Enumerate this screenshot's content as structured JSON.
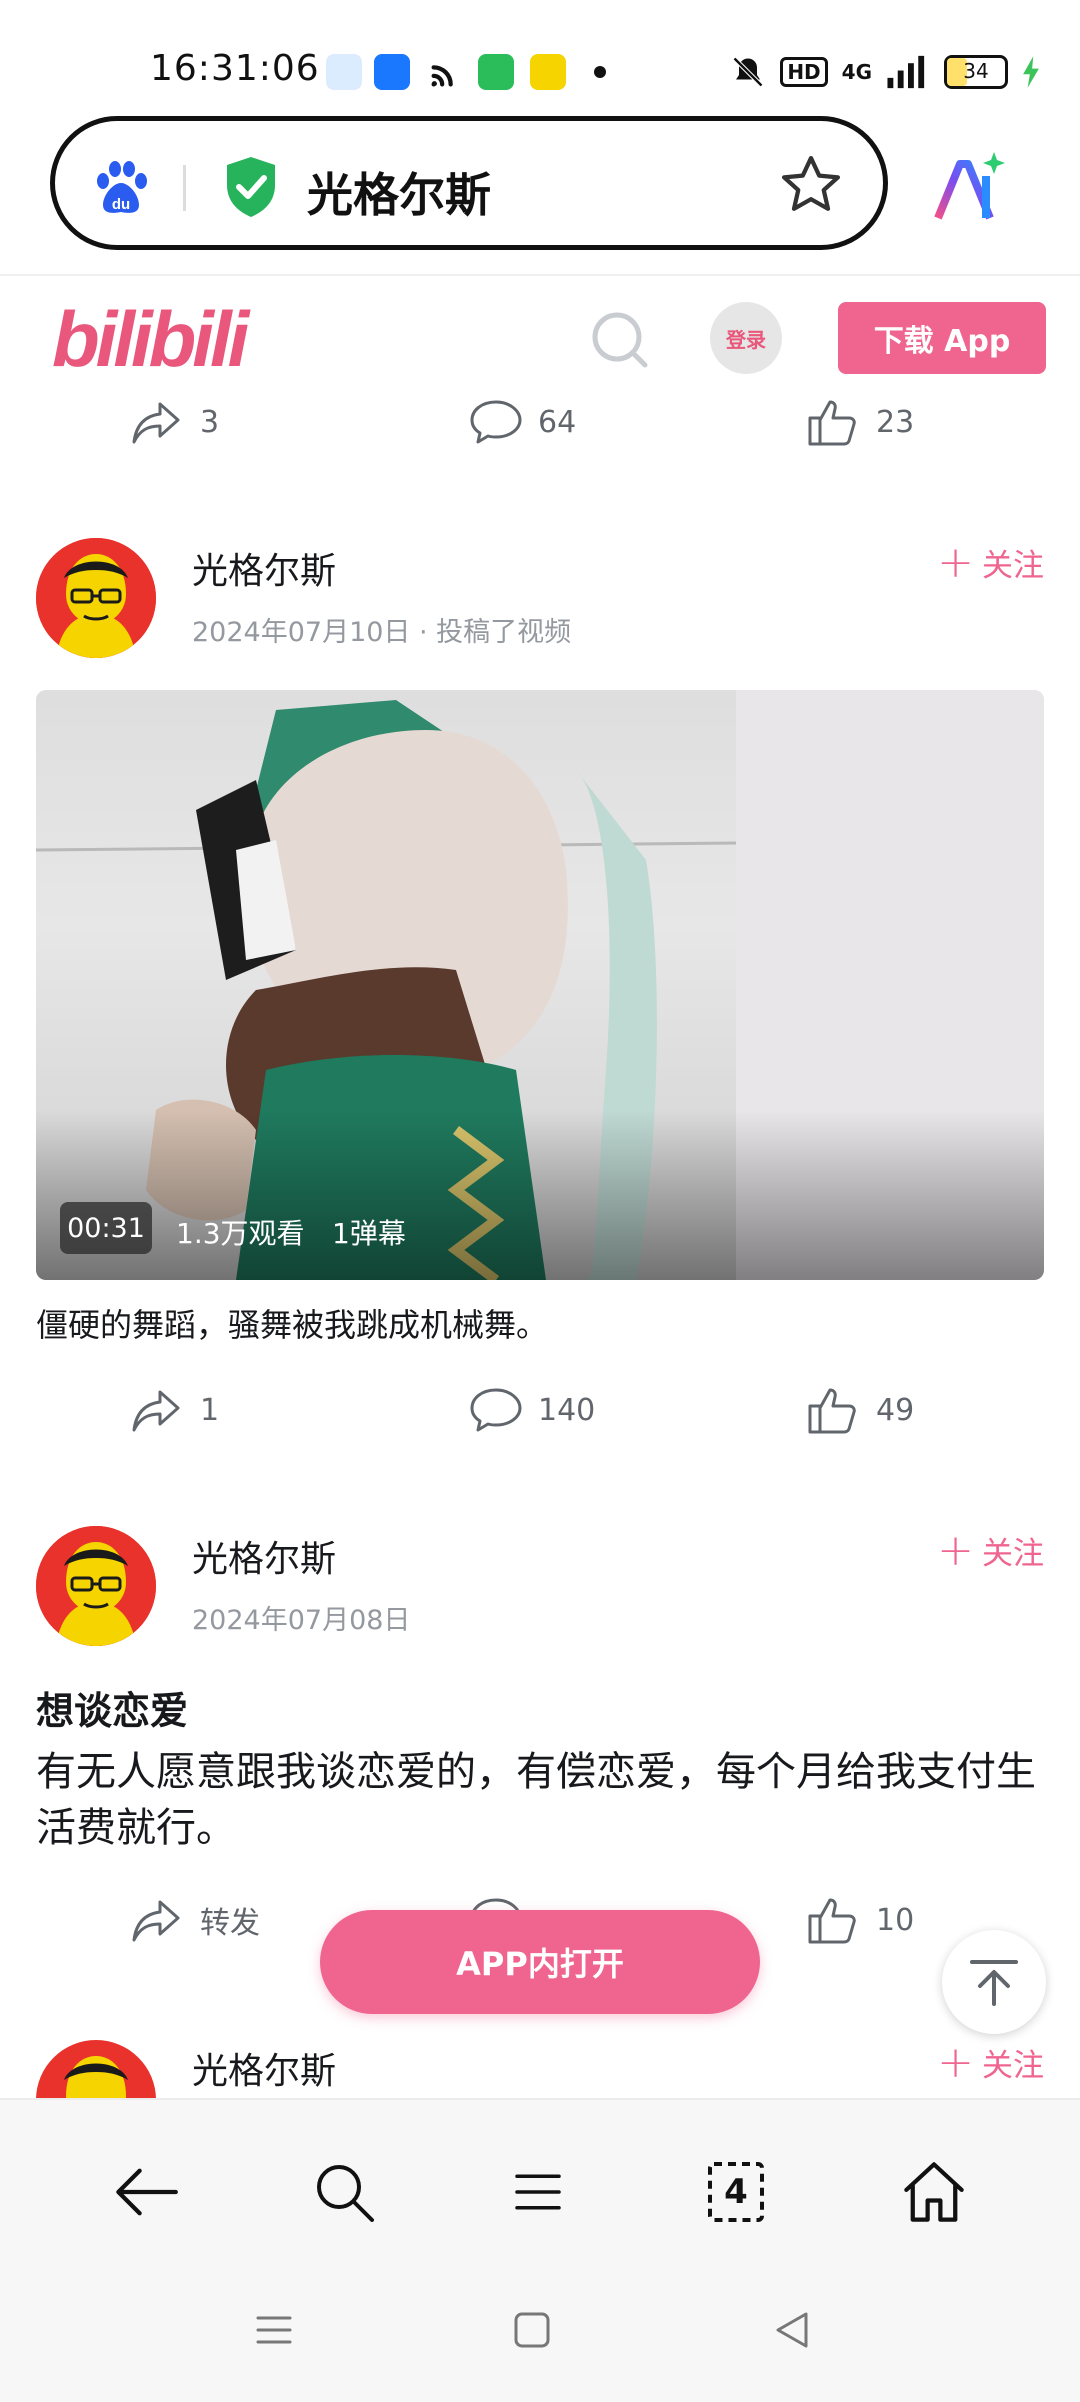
{
  "status_bar": {
    "time": "16:31:06",
    "network": "4G",
    "hd": "HD",
    "battery": "34",
    "battery_fraction": 0.34
  },
  "browser": {
    "url_title": "光格尔斯"
  },
  "header": {
    "logo": "bilibili",
    "login": "登录",
    "download": "下载 App"
  },
  "post1": {
    "share": "3",
    "comments": "64",
    "likes": "23"
  },
  "post2": {
    "author": "光格尔斯",
    "meta": "2024年07月10日 · 投稿了视频",
    "follow": "关注",
    "duration": "00:31",
    "views": "1.3万观看",
    "danmaku": "1弹幕",
    "caption": "僵硬的舞蹈，骚舞被我跳成机械舞。",
    "share": "1",
    "comments": "140",
    "likes": "49"
  },
  "post3": {
    "author": "光格尔斯",
    "meta": "2024年07月08日",
    "follow": "关注",
    "title": "想谈恋爱",
    "body": "有无人愿意跟我谈恋爱的，有偿恋爱，每个月给我支付生活费就行。",
    "share": "转发",
    "likes": "10"
  },
  "post4": {
    "author": "光格尔斯",
    "follow": "关注"
  },
  "floating": {
    "open_app": "APP内打开"
  },
  "toolbar": {
    "tabs_count": "4"
  },
  "colors": {
    "brand_pink": "#f0658f",
    "bili_logo": "#e9587c"
  }
}
